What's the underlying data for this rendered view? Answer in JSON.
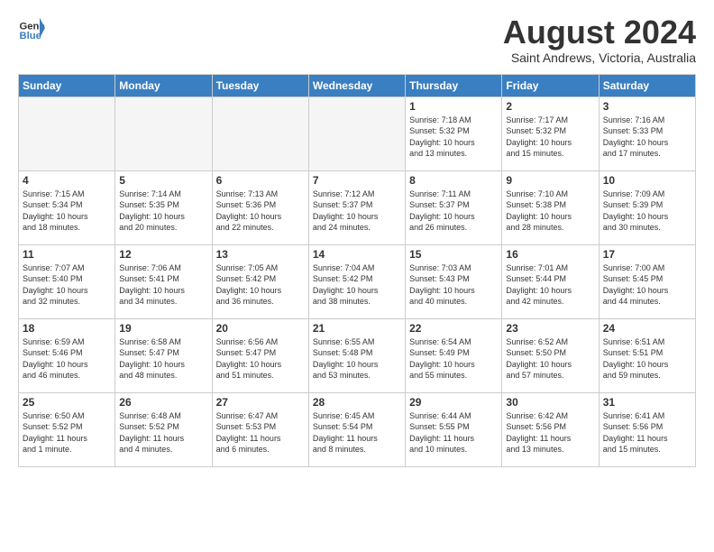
{
  "logo": {
    "general": "General",
    "blue": "Blue"
  },
  "title": "August 2024",
  "location": "Saint Andrews, Victoria, Australia",
  "days_header": [
    "Sunday",
    "Monday",
    "Tuesday",
    "Wednesday",
    "Thursday",
    "Friday",
    "Saturday"
  ],
  "weeks": [
    [
      {
        "day": "",
        "info": ""
      },
      {
        "day": "",
        "info": ""
      },
      {
        "day": "",
        "info": ""
      },
      {
        "day": "",
        "info": ""
      },
      {
        "day": "1",
        "info": "Sunrise: 7:18 AM\nSunset: 5:32 PM\nDaylight: 10 hours\nand 13 minutes."
      },
      {
        "day": "2",
        "info": "Sunrise: 7:17 AM\nSunset: 5:32 PM\nDaylight: 10 hours\nand 15 minutes."
      },
      {
        "day": "3",
        "info": "Sunrise: 7:16 AM\nSunset: 5:33 PM\nDaylight: 10 hours\nand 17 minutes."
      }
    ],
    [
      {
        "day": "4",
        "info": "Sunrise: 7:15 AM\nSunset: 5:34 PM\nDaylight: 10 hours\nand 18 minutes."
      },
      {
        "day": "5",
        "info": "Sunrise: 7:14 AM\nSunset: 5:35 PM\nDaylight: 10 hours\nand 20 minutes."
      },
      {
        "day": "6",
        "info": "Sunrise: 7:13 AM\nSunset: 5:36 PM\nDaylight: 10 hours\nand 22 minutes."
      },
      {
        "day": "7",
        "info": "Sunrise: 7:12 AM\nSunset: 5:37 PM\nDaylight: 10 hours\nand 24 minutes."
      },
      {
        "day": "8",
        "info": "Sunrise: 7:11 AM\nSunset: 5:37 PM\nDaylight: 10 hours\nand 26 minutes."
      },
      {
        "day": "9",
        "info": "Sunrise: 7:10 AM\nSunset: 5:38 PM\nDaylight: 10 hours\nand 28 minutes."
      },
      {
        "day": "10",
        "info": "Sunrise: 7:09 AM\nSunset: 5:39 PM\nDaylight: 10 hours\nand 30 minutes."
      }
    ],
    [
      {
        "day": "11",
        "info": "Sunrise: 7:07 AM\nSunset: 5:40 PM\nDaylight: 10 hours\nand 32 minutes."
      },
      {
        "day": "12",
        "info": "Sunrise: 7:06 AM\nSunset: 5:41 PM\nDaylight: 10 hours\nand 34 minutes."
      },
      {
        "day": "13",
        "info": "Sunrise: 7:05 AM\nSunset: 5:42 PM\nDaylight: 10 hours\nand 36 minutes."
      },
      {
        "day": "14",
        "info": "Sunrise: 7:04 AM\nSunset: 5:42 PM\nDaylight: 10 hours\nand 38 minutes."
      },
      {
        "day": "15",
        "info": "Sunrise: 7:03 AM\nSunset: 5:43 PM\nDaylight: 10 hours\nand 40 minutes."
      },
      {
        "day": "16",
        "info": "Sunrise: 7:01 AM\nSunset: 5:44 PM\nDaylight: 10 hours\nand 42 minutes."
      },
      {
        "day": "17",
        "info": "Sunrise: 7:00 AM\nSunset: 5:45 PM\nDaylight: 10 hours\nand 44 minutes."
      }
    ],
    [
      {
        "day": "18",
        "info": "Sunrise: 6:59 AM\nSunset: 5:46 PM\nDaylight: 10 hours\nand 46 minutes."
      },
      {
        "day": "19",
        "info": "Sunrise: 6:58 AM\nSunset: 5:47 PM\nDaylight: 10 hours\nand 48 minutes."
      },
      {
        "day": "20",
        "info": "Sunrise: 6:56 AM\nSunset: 5:47 PM\nDaylight: 10 hours\nand 51 minutes."
      },
      {
        "day": "21",
        "info": "Sunrise: 6:55 AM\nSunset: 5:48 PM\nDaylight: 10 hours\nand 53 minutes."
      },
      {
        "day": "22",
        "info": "Sunrise: 6:54 AM\nSunset: 5:49 PM\nDaylight: 10 hours\nand 55 minutes."
      },
      {
        "day": "23",
        "info": "Sunrise: 6:52 AM\nSunset: 5:50 PM\nDaylight: 10 hours\nand 57 minutes."
      },
      {
        "day": "24",
        "info": "Sunrise: 6:51 AM\nSunset: 5:51 PM\nDaylight: 10 hours\nand 59 minutes."
      }
    ],
    [
      {
        "day": "25",
        "info": "Sunrise: 6:50 AM\nSunset: 5:52 PM\nDaylight: 11 hours\nand 1 minute."
      },
      {
        "day": "26",
        "info": "Sunrise: 6:48 AM\nSunset: 5:52 PM\nDaylight: 11 hours\nand 4 minutes."
      },
      {
        "day": "27",
        "info": "Sunrise: 6:47 AM\nSunset: 5:53 PM\nDaylight: 11 hours\nand 6 minutes."
      },
      {
        "day": "28",
        "info": "Sunrise: 6:45 AM\nSunset: 5:54 PM\nDaylight: 11 hours\nand 8 minutes."
      },
      {
        "day": "29",
        "info": "Sunrise: 6:44 AM\nSunset: 5:55 PM\nDaylight: 11 hours\nand 10 minutes."
      },
      {
        "day": "30",
        "info": "Sunrise: 6:42 AM\nSunset: 5:56 PM\nDaylight: 11 hours\nand 13 minutes."
      },
      {
        "day": "31",
        "info": "Sunrise: 6:41 AM\nSunset: 5:56 PM\nDaylight: 11 hours\nand 15 minutes."
      }
    ]
  ]
}
